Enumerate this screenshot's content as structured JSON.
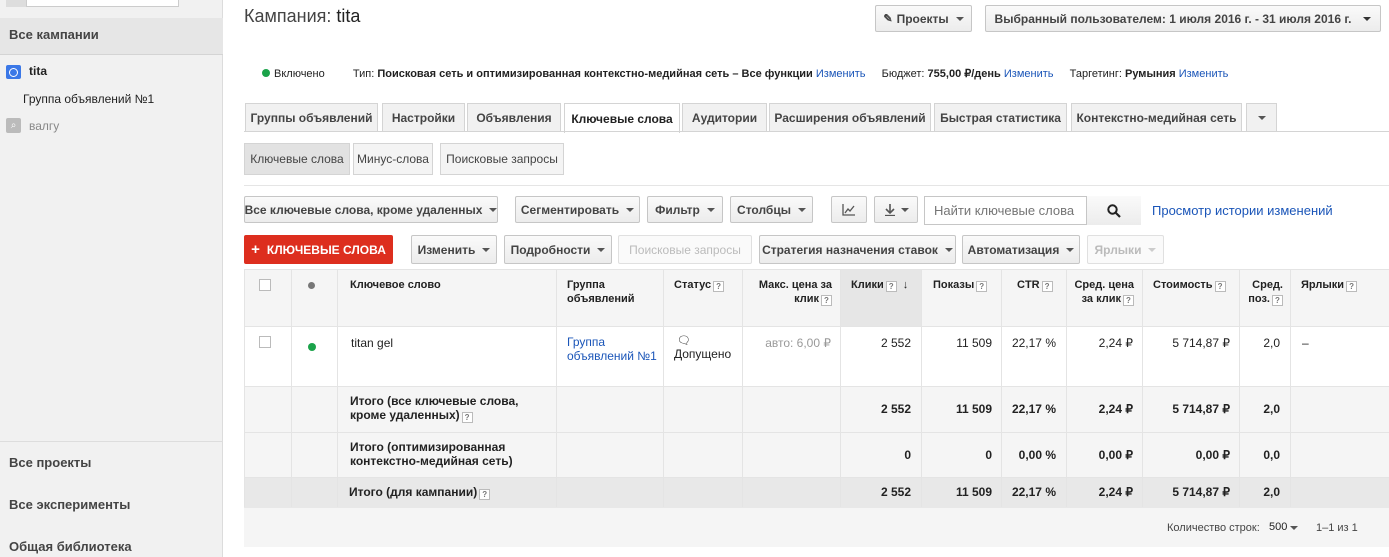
{
  "sidebar": {
    "all_campaigns": "Все кампании",
    "campaign": "tita",
    "ad_group": "Группа объявлений №1",
    "keyword": "валгу",
    "bottom": [
      "Все проекты",
      "Все эксперименты",
      "Общая библиотека"
    ]
  },
  "header": {
    "title_prefix": "Кампания:",
    "title_name": "tita",
    "projects_button": "Проекты",
    "date_range": "Выбранный пользователем: 1 июля 2016 г. - 31 июля 2016 г."
  },
  "info": {
    "status": "Включено",
    "type_label": "Тип:",
    "type_value": "Поисковая сеть и оптимизированная контекстно-медийная сеть – Все функции",
    "type_edit": "Изменить",
    "budget_label": "Бюджет:",
    "budget_value": "755,00 ₽/день",
    "budget_edit": "Изменить",
    "targeting_label": "Таргетинг:",
    "targeting_value": "Румыния",
    "targeting_edit": "Изменить"
  },
  "tabs": [
    "Группы объявлений",
    "Настройки",
    "Объявления",
    "Ключевые слова",
    "Аудитории",
    "Расширения объявлений",
    "Быстрая статистика",
    "Контекстно-медийная сеть"
  ],
  "active_tab": "Ключевые слова",
  "subtabs": [
    "Ключевые слова",
    "Минус-слова",
    "Поисковые запросы"
  ],
  "toolbar1": {
    "filter_all": "Все ключевые слова, кроме удаленных",
    "segment": "Сегментировать",
    "filter": "Фильтр",
    "columns": "Столбцы",
    "search_placeholder": "Найти ключевые слова",
    "history_link": "Просмотр истории изменений"
  },
  "toolbar2": {
    "add": "КЛЮЧЕВЫЕ СЛОВА",
    "edit": "Изменить",
    "details": "Подробности",
    "search_terms": "Поисковые запросы",
    "bid_strategy": "Стратегия назначения ставок",
    "automate": "Автоматизация",
    "labels": "Ярлыки"
  },
  "table": {
    "headers": {
      "keyword": "Ключевое слово",
      "ad_group": "Группа объявлений",
      "status": "Статус",
      "max_cpc": "Макс. цена за клик",
      "clicks": "Клики",
      "impressions": "Показы",
      "ctr": "CTR",
      "avg_cpc": "Сред. цена за клик",
      "cost": "Стоимость",
      "avg_pos": "Сред. поз.",
      "labels": "Ярлыки"
    },
    "row": {
      "keyword": "titan gel",
      "ad_group": "Группа объявлений №1",
      "status": "Допущено",
      "max_cpc": "авто: 6,00 ₽",
      "clicks": "2 552",
      "impressions": "11 509",
      "ctr": "22,17 %",
      "avg_cpc": "2,24 ₽",
      "cost": "5 714,87 ₽",
      "avg_pos": "2,0",
      "labels": "–"
    },
    "totals": [
      {
        "label": "Итого (все ключевые слова, кроме удаленных)",
        "clicks": "2 552",
        "impressions": "11 509",
        "ctr": "22,17 %",
        "avg_cpc": "2,24 ₽",
        "cost": "5 714,87 ₽",
        "avg_pos": "2,0"
      },
      {
        "label": "Итого (оптимизированная контекстно-медийная сеть)",
        "clicks": "0",
        "impressions": "0",
        "ctr": "0,00 %",
        "avg_cpc": "0,00 ₽",
        "cost": "0,00 ₽",
        "avg_pos": "0,0"
      },
      {
        "label": "Итого (для кампании)",
        "clicks": "2 552",
        "impressions": "11 509",
        "ctr": "22,17 %",
        "avg_cpc": "2,24 ₽",
        "cost": "5 714,87 ₽",
        "avg_pos": "2,0"
      }
    ]
  },
  "pagination": {
    "rows_label": "Количество строк:",
    "rows_value": "500",
    "range": "1–1 из 1"
  },
  "colors": {
    "add_button": "#dd2e1e",
    "link": "#1a55b8",
    "status_green": "#1ba34a"
  }
}
